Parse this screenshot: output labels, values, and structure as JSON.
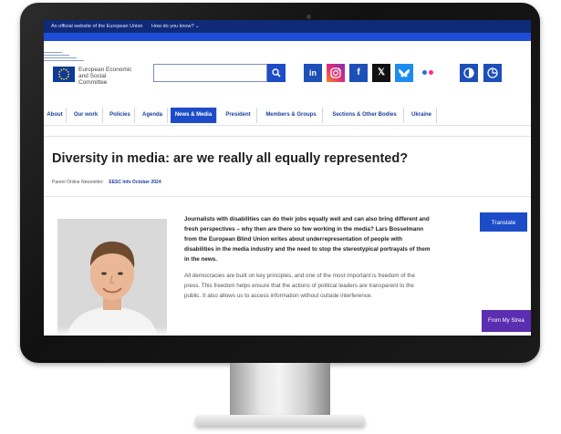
{
  "eu_bar": {
    "official_text": "An official website of the European Union",
    "link_text": "How do you know? ⌄"
  },
  "logo": {
    "line1": "European Economic",
    "line2": "and Social",
    "line3": "Committee"
  },
  "social": {
    "linkedin": "in",
    "facebook": "f",
    "x": "𝕏"
  },
  "nav": {
    "items": [
      "About",
      "Our work",
      "Policies",
      "Agenda",
      "News & Media",
      "President",
      "Members & Groups",
      "Sections & Other Bodies",
      "Ukraine"
    ],
    "active": "News & Media"
  },
  "article": {
    "title": "Diversity in media: are we really all equally represented?",
    "meta_label": "Parent Online Newsletter:",
    "meta_value": "EESC Info October 2024",
    "lead": "Journalists with disabilities can do their jobs equally well and can also bring different and fresh perspectives – why then are there so few working in the media? Lars Bosselmann from the European Blind Union writes about underrepresentation of people with disabilities in the media industry and the need to stop the stereotypical portrayals of them in the news.",
    "paragraph": "All democracies are built on key principles, and one of the most important is freedom of the press. This freedom helps ensure that the actions of political leaders are transparent to the public. It also allows us to access information without outside interference."
  },
  "buttons": {
    "translate": "Translate",
    "stream": "From My Strea"
  },
  "colors": {
    "eu_dark_blue": "#0e2a78",
    "eu_blue": "#1d4cc8",
    "stream_purple": "#5b2db0"
  }
}
